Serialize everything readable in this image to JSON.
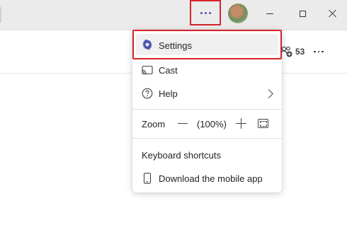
{
  "titlebar": {
    "more_button_icon": "more-horizontal-icon",
    "accent_color": "#4f52b2",
    "highlight_color": "#d8232a",
    "minimize_icon": "minimize-icon",
    "maximize_icon": "maximize-icon",
    "close_icon": "close-icon"
  },
  "subbar": {
    "participants_count": "53",
    "participants_icon": "people-add-icon",
    "more_icon": "more-horizontal-icon"
  },
  "menu": {
    "settings": {
      "label": "Settings",
      "icon": "gear-icon"
    },
    "cast": {
      "label": "Cast",
      "icon": "cast-icon"
    },
    "help": {
      "label": "Help",
      "icon": "help-circle-icon"
    },
    "zoom": {
      "label": "Zoom",
      "value": "(100%)",
      "decrease_icon": "minus-icon",
      "increase_icon": "plus-icon",
      "fullscreen_icon": "fullscreen-icon"
    },
    "keyboard_shortcuts": {
      "label": "Keyboard shortcuts"
    },
    "download_mobile": {
      "label": "Download the mobile app",
      "icon": "phone-icon"
    }
  }
}
